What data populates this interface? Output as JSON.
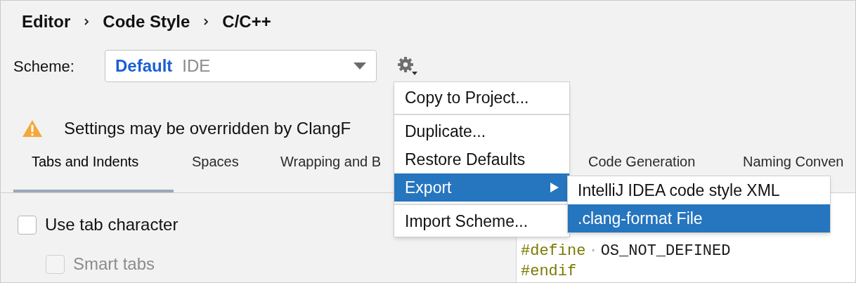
{
  "breadcrumb": [
    "Editor",
    "Code Style",
    "C/C++"
  ],
  "scheme": {
    "label": "Scheme:",
    "name": "Default",
    "type": "IDE"
  },
  "warning": {
    "text": "Settings may be overridden by ClangF"
  },
  "tabs": [
    {
      "label": "Tabs and Indents",
      "selected": true
    },
    {
      "label": "Spaces",
      "selected": false
    },
    {
      "label": "Wrapping and B",
      "selected": false
    },
    {
      "label": "Code Generation",
      "selected": false
    },
    {
      "label": "Naming Conven",
      "selected": false
    }
  ],
  "options": [
    {
      "label": "Use tab character",
      "checked": false,
      "disabled": false
    },
    {
      "label": "Smart tabs",
      "checked": false,
      "disabled": true
    }
  ],
  "code_lines": [
    {
      "tokens": [
        {
          "kind": "keyword",
          "text": "#define"
        },
        {
          "kind": "whitespace",
          "text": "·"
        },
        {
          "kind": "ident",
          "text": "OS_NOT_DEFINED"
        }
      ]
    },
    {
      "tokens": [
        {
          "kind": "keyword",
          "text": "#endif"
        }
      ]
    }
  ],
  "menu": {
    "items": [
      {
        "label": "Copy to Project...",
        "selected": false,
        "separator_before": false,
        "submenu": false
      },
      {
        "label": "Duplicate...",
        "selected": false,
        "separator_before": true,
        "submenu": false
      },
      {
        "label": "Restore Defaults",
        "selected": false,
        "separator_before": false,
        "submenu": false
      },
      {
        "label": "Export",
        "selected": true,
        "separator_before": false,
        "submenu": true
      },
      {
        "label": "Import Scheme...",
        "selected": false,
        "separator_before": true,
        "submenu": false
      }
    ],
    "submenu": [
      {
        "label": "IntelliJ IDEA code style XML",
        "selected": false
      },
      {
        "label": ".clang-format File",
        "selected": true
      }
    ]
  }
}
